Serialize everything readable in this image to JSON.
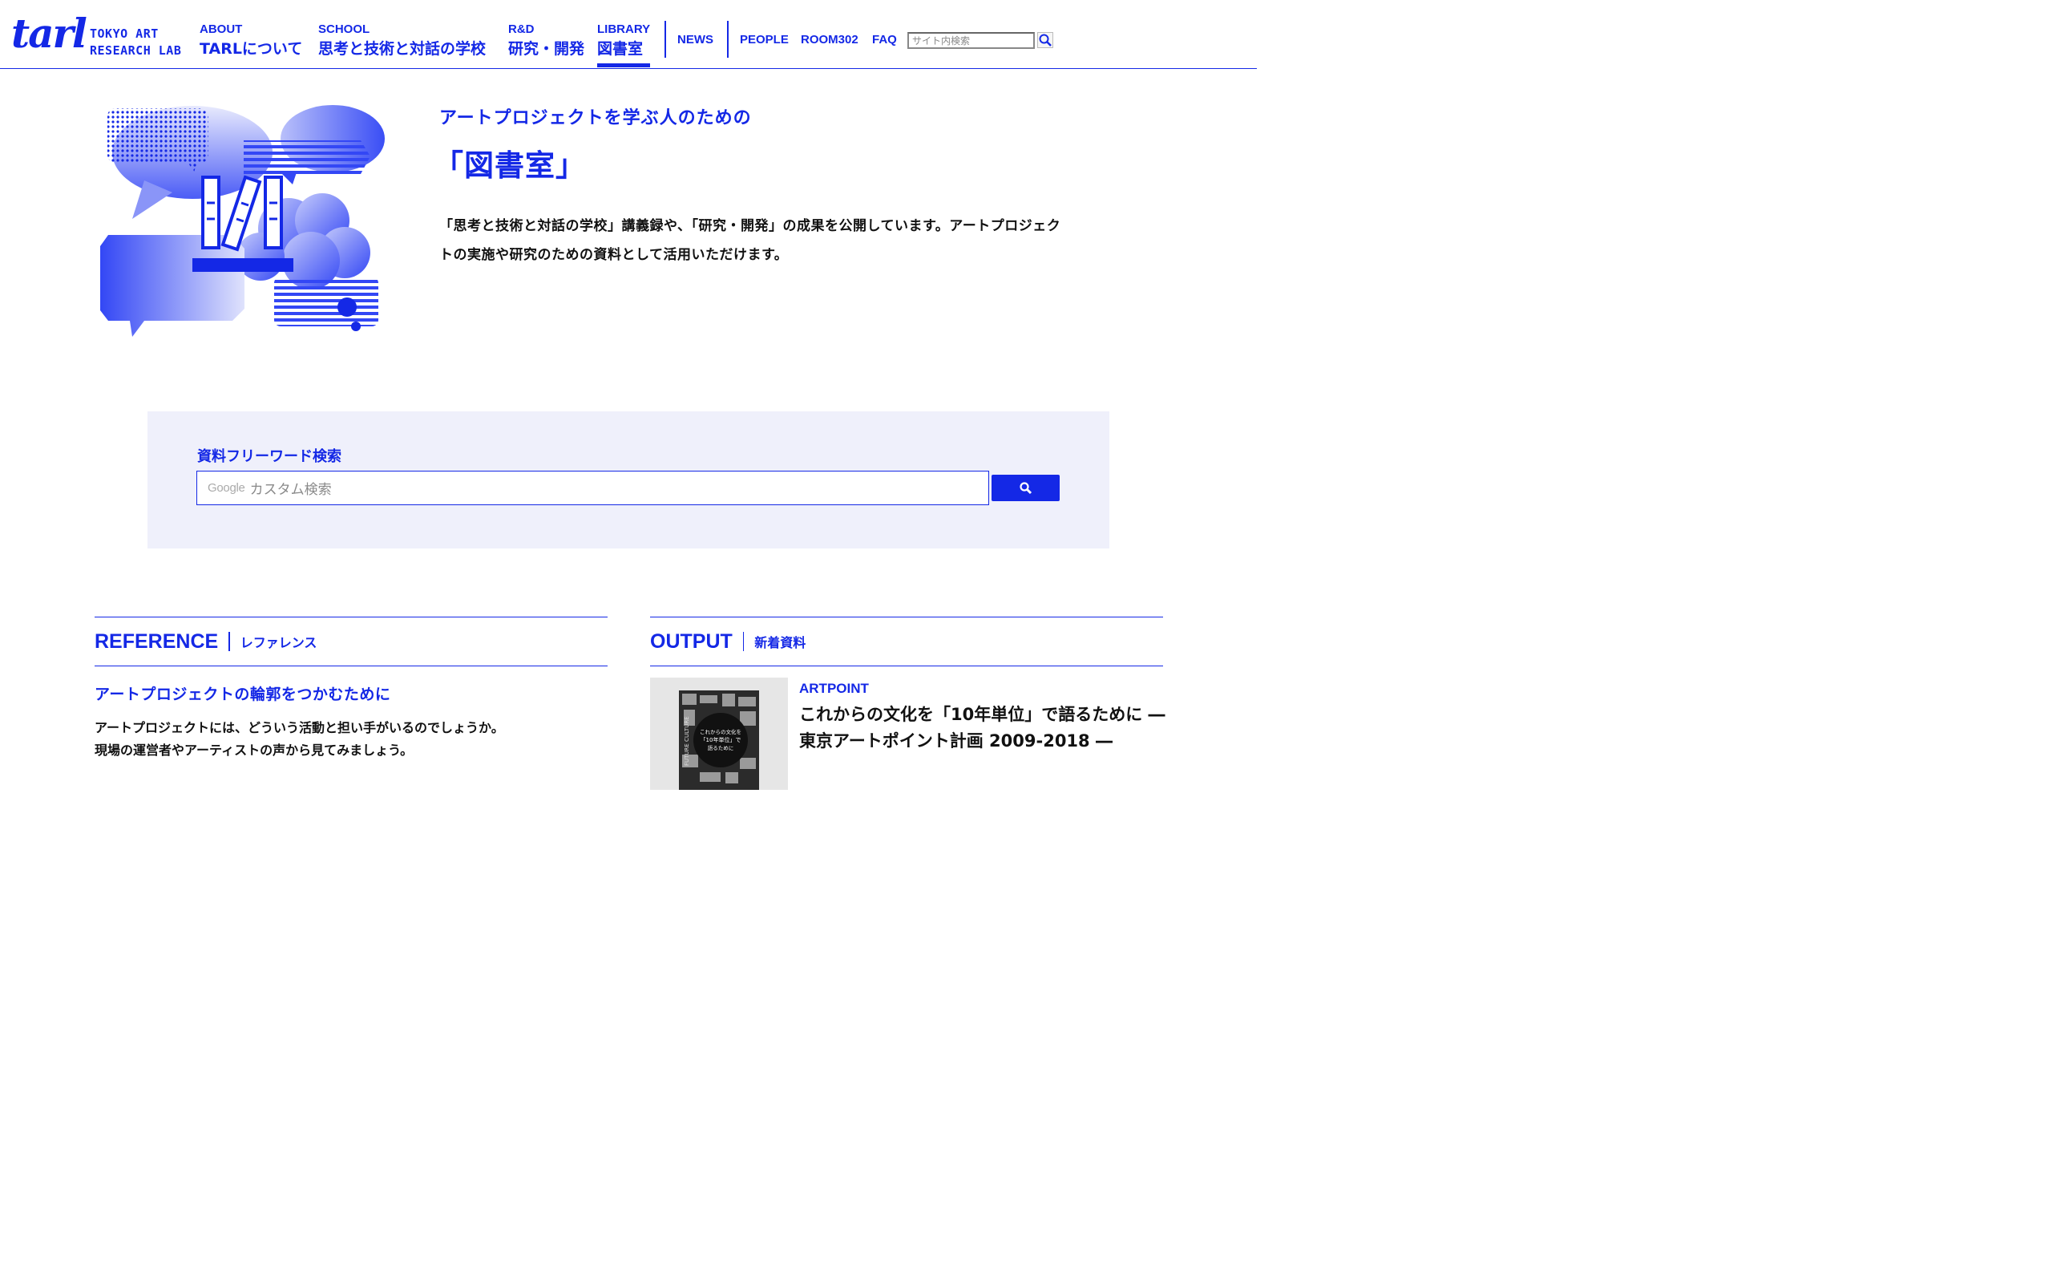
{
  "header": {
    "logo_text_line1": "TOKYO ART",
    "logo_text_line2": "RESEARCH LAB",
    "logo_mark": "tarl",
    "nav": [
      {
        "en": "ABOUT",
        "ja": "TARLについて"
      },
      {
        "en": "SCHOOL",
        "ja": "思考と技術と対話の学校"
      },
      {
        "en": "R&D",
        "ja": "研究・開発"
      },
      {
        "en": "LIBRARY",
        "ja": "図書室",
        "active": true
      }
    ],
    "news": "NEWS",
    "people": "PEOPLE",
    "room": "ROOM302",
    "faq": "FAQ",
    "search_placeholder": "サイト内検索",
    "search_icon": "magnifier-icon"
  },
  "hero": {
    "subtitle": "アートプロジェクトを学ぶ人のための",
    "title": "「図書室」",
    "description": "「思考と技術と対話の学校」講義録や、「研究・開発」の成果を公開しています。アートプロジェクトの実施や研究のための資料として活用いただけます。"
  },
  "search_panel": {
    "label": "資料フリーワード検索",
    "google_mark": "Google",
    "placeholder": "カスタム検索",
    "button_icon": "search-icon"
  },
  "reference": {
    "heading_en": "REFERENCE",
    "heading_ja": "レファレンス",
    "item_title": "アートプロジェクトの輪郭をつかむために",
    "item_text_line1": "アートプロジェクトには、どういう活動と担い手がいるのでしょうか。",
    "item_text_line2": "現場の運営者やアーティストの声から見てみましょう。"
  },
  "output": {
    "heading_en": "OUTPUT",
    "heading_ja": "新着資料",
    "category": "ARTPOINT",
    "item_title": "これからの文化を「10年単位」で語るために ― 東京アートポイント計画 2009-2018 ―",
    "thumb_text": "これからの文化を「10年単位」で語るために",
    "thumb_side": "FUTURE CULTURE"
  },
  "colors": {
    "accent": "#1428e6",
    "panel_bg": "#eff0fb"
  }
}
